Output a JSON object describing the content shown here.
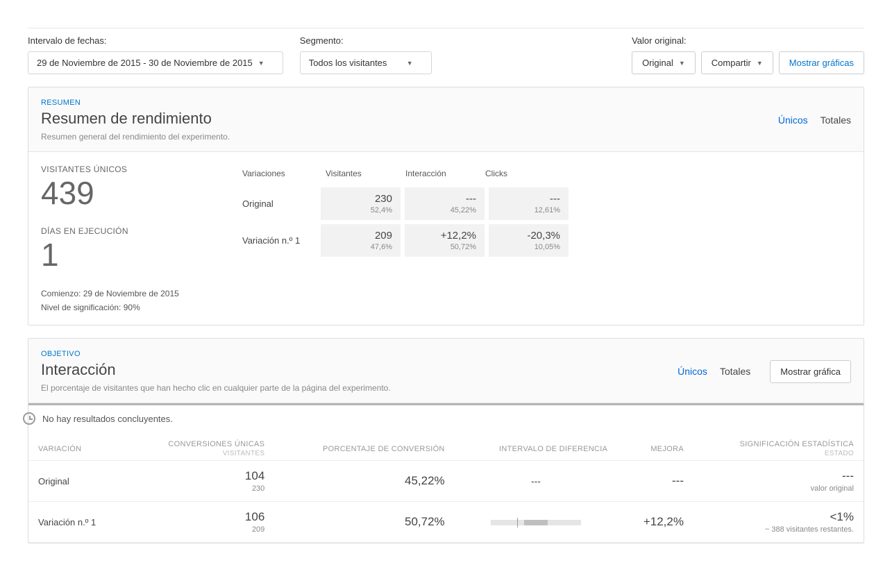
{
  "filters": {
    "date_label": "Intervalo de fechas:",
    "date_value": "29 de Noviembre de 2015 - 30 de Noviembre de 2015",
    "segment_label": "Segmento:",
    "segment_value": "Todos los visitantes",
    "original_label": "Valor original:",
    "original_value": "Original",
    "share_label": "Compartir",
    "show_charts_label": "Mostrar gráficas"
  },
  "summary": {
    "eyebrow": "RESUMEN",
    "title": "Resumen de rendimiento",
    "subtitle": "Resumen general del rendimiento del experimento.",
    "tab_unique": "Únicos",
    "tab_totals": "Totales",
    "visitors_label": "VISITANTES ÚNICOS",
    "visitors_value": "439",
    "days_label": "DÍAS EN EJECUCIÓN",
    "days_value": "1",
    "start_line": "Comienzo: 29 de Noviembre de 2015",
    "signif_line": "Nivel de significación: 90%",
    "cols": {
      "variations": "Variaciones",
      "visitors": "Visitantes",
      "interaction": "Interacción",
      "clicks": "Clicks"
    },
    "rows": [
      {
        "name": "Original",
        "visitors_main": "230",
        "visitors_sub": "52,4%",
        "interaction_main": "---",
        "interaction_sub": "45,22%",
        "clicks_main": "---",
        "clicks_sub": "12,61%"
      },
      {
        "name": "Variación n.º 1",
        "visitors_main": "209",
        "visitors_sub": "47,6%",
        "interaction_main": "+12,2%",
        "interaction_sub": "50,72%",
        "clicks_main": "-20,3%",
        "clicks_sub": "10,05%"
      }
    ]
  },
  "goal": {
    "eyebrow": "OBJETIVO",
    "title": "Interacción",
    "subtitle": "El porcentaje de visitantes que han hecho clic en cualquier parte de la página del experimento.",
    "tab_unique": "Únicos",
    "tab_totals": "Totales",
    "show_chart_label": "Mostrar gráfica",
    "no_results": "No hay resultados concluyentes.",
    "headers": {
      "variation": "VARIACIÓN",
      "conversions": "CONVERSIONES ÚNICAS",
      "conversions_sub": "VISITANTES",
      "rate": "PORCENTAJE DE CONVERSIÓN",
      "interval": "INTERVALO DE DIFERENCIA",
      "improvement": "MEJORA",
      "significance": "SIGNIFICACIÓN ESTADÍSTICA",
      "significance_sub": "ESTADO"
    },
    "rows": [
      {
        "name": "Original",
        "conv_main": "104",
        "conv_sub": "230",
        "rate": "45,22%",
        "interval": "---",
        "improvement": "---",
        "signif_main": "---",
        "signif_sub": "valor original",
        "show_bar": false
      },
      {
        "name": "Variación n.º 1",
        "conv_main": "106",
        "conv_sub": "209",
        "rate": "50,72%",
        "interval": "",
        "improvement": "+12,2%",
        "signif_main": "<1%",
        "signif_sub": "~ 388 visitantes restantes.",
        "show_bar": true
      }
    ]
  }
}
